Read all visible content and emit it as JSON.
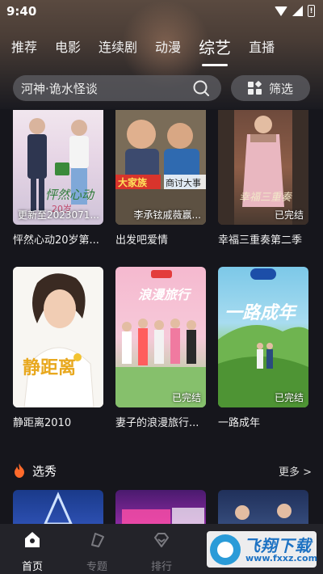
{
  "status": {
    "time": "9:40",
    "battery": "!"
  },
  "tabs": [
    {
      "label": "推荐",
      "active": false
    },
    {
      "label": "电影",
      "active": false
    },
    {
      "label": "连续剧",
      "active": false
    },
    {
      "label": "动漫",
      "active": false
    },
    {
      "label": "综艺",
      "active": true
    },
    {
      "label": "直播",
      "active": false
    }
  ],
  "search": {
    "text": "河神·诡水怪谈",
    "filter_label": "筛选"
  },
  "rows": [
    {
      "cards": [
        {
          "title": "怦然心动20岁第...",
          "poster_text": "更新至2023071...",
          "poster_label_side": "left",
          "theme": "pink",
          "poster_caption": "怦然心动20岁"
        },
        {
          "title": "出发吧爱情",
          "poster_text": "李承铉戚薇赢...",
          "poster_label_side": "right",
          "theme": "warm",
          "poster_caption": "商讨大事"
        },
        {
          "title": "幸福三重奏第二季",
          "poster_text": "已完结",
          "poster_label_side": "right",
          "theme": "brick",
          "poster_caption": "幸福三重奏"
        }
      ]
    },
    {
      "cards": [
        {
          "title": "静距离2010",
          "poster_text": "",
          "poster_label_side": "right",
          "theme": "white",
          "poster_caption": "静距离"
        },
        {
          "title": "妻子的浪漫旅行...",
          "poster_text": "已完结",
          "poster_label_side": "right",
          "theme": "party",
          "poster_caption": "妻子的浪漫旅行"
        },
        {
          "title": "一路成年",
          "poster_text": "已完结",
          "poster_label_side": "right",
          "theme": "green",
          "poster_caption": "一路成年"
        }
      ]
    }
  ],
  "section": {
    "title": "选秀",
    "more": "更多 >"
  },
  "bottom_nav": [
    {
      "label": "首页",
      "active": true
    },
    {
      "label": "专题",
      "active": false
    },
    {
      "label": "排行",
      "active": false
    }
  ],
  "watermark": {
    "name": "飞翔下载",
    "url": "www.fxxz.com"
  },
  "colors": {
    "background": "#16161c",
    "nav_bg": "#232329",
    "accent": "#ff6a2b"
  }
}
